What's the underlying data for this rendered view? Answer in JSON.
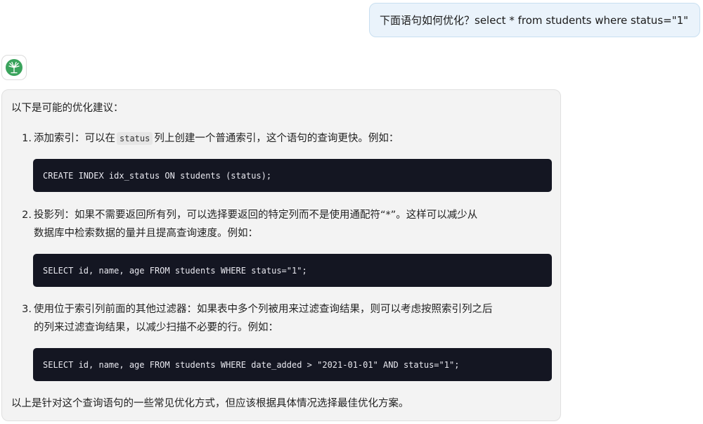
{
  "user_message": "下面语句如何优化？select * from students where status=\"1\"",
  "assistant": {
    "avatar_icon": "tree-logo-icon",
    "brand_color": "#3aa35c",
    "intro": "以下是可能的优化建议：",
    "items": [
      {
        "number": "1.",
        "text_before_code": "添加索引：可以在",
        "inline_code": "status",
        "text_after_code": "列上创建一个普通索引，这个语句的查询更快。例如：",
        "code": "CREATE INDEX idx_status ON students (status);"
      },
      {
        "number": "2.",
        "line1": "投影列：如果不需要返回所有列，可以选择要返回的特定列而不是使用通配符“*”。这样可以减少从",
        "line2": "数据库中检索数据的量并且提高查询速度。例如：",
        "code": "SELECT id, name, age FROM students WHERE status=\"1\";"
      },
      {
        "number": "3.",
        "line1": "使用位于索引列前面的其他过滤器：如果表中多个列被用来过滤查询结果，则可以考虑按照索引列之后",
        "line2": "的列来过滤查询结果，以减少扫描不必要的行。例如：",
        "code": "SELECT id, name, age FROM students WHERE date_added > \"2021-01-01\" AND status=\"1\";"
      }
    ],
    "conclusion": "以上是针对这个查询语句的一些常见优化方式，但应该根据具体情况选择最佳优化方案。"
  }
}
